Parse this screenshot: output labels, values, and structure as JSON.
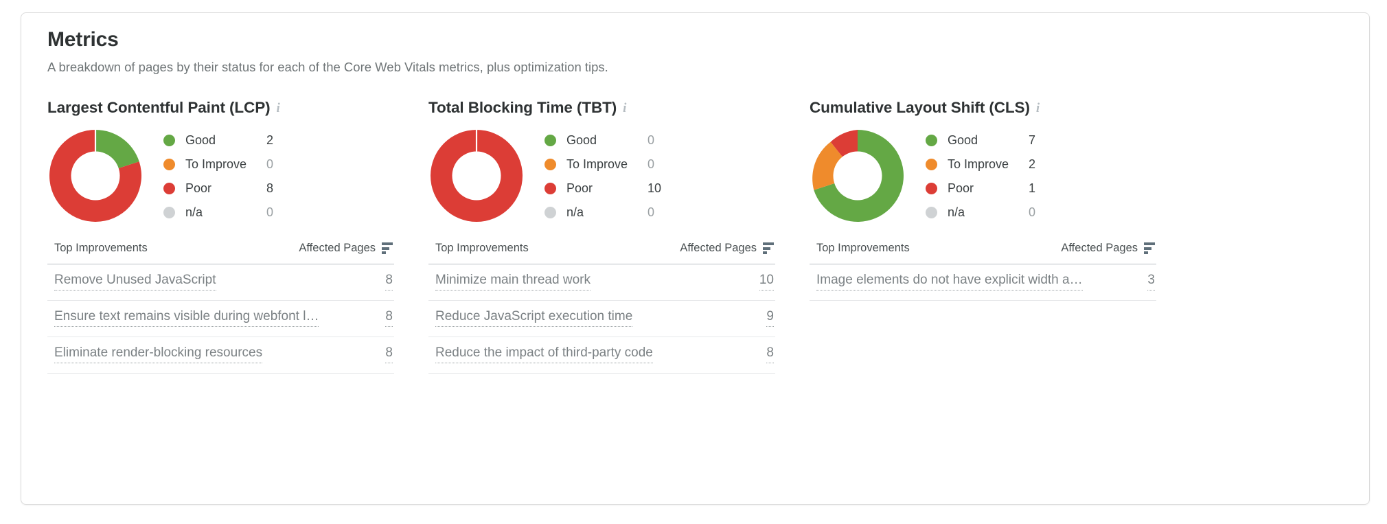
{
  "card": {
    "title": "Metrics",
    "subtitle": "A breakdown of pages by their status for each of the Core Web Vitals metrics, plus optimization tips."
  },
  "colors": {
    "good": "#64a845",
    "to_improve": "#ef8b2c",
    "poor": "#dc3d36",
    "na": "#cfd2d4",
    "title": "#2e3233",
    "subtitle": "#6f7577",
    "link": "#7b8184",
    "sort_icon": "#5f6f7a",
    "info_icon": "#b6bdc2"
  },
  "table_headers": {
    "improvements": "Top Improvements",
    "affected_pages": "Affected Pages",
    "sort_icon": "sort-descending-icon"
  },
  "metrics": [
    {
      "id": "lcp",
      "title": "Largest Contentful Paint (LCP)",
      "info_icon": "info-icon",
      "legend": [
        {
          "label": "Good",
          "value": "2",
          "color": "#64a845"
        },
        {
          "label": "To Improve",
          "value": "0",
          "color": "#ef8b2c"
        },
        {
          "label": "Poor",
          "value": "8",
          "color": "#dc3d36"
        },
        {
          "label": "n/a",
          "value": "0",
          "color": "#cfd2d4"
        }
      ],
      "rows": [
        {
          "name": "Remove Unused JavaScript",
          "value": "8"
        },
        {
          "name": "Ensure text remains visible during webfont l…",
          "value": "8"
        },
        {
          "name": "Eliminate render-blocking resources",
          "value": "8"
        }
      ]
    },
    {
      "id": "tbt",
      "title": "Total Blocking Time (TBT)",
      "info_icon": "info-icon",
      "legend": [
        {
          "label": "Good",
          "value": "0",
          "color": "#64a845"
        },
        {
          "label": "To Improve",
          "value": "0",
          "color": "#ef8b2c"
        },
        {
          "label": "Poor",
          "value": "10",
          "color": "#dc3d36"
        },
        {
          "label": "n/a",
          "value": "0",
          "color": "#cfd2d4"
        }
      ],
      "rows": [
        {
          "name": "Minimize main thread work",
          "value": "10"
        },
        {
          "name": "Reduce JavaScript execution time",
          "value": "9"
        },
        {
          "name": "Reduce the impact of third-party code",
          "value": "8"
        }
      ]
    },
    {
      "id": "cls",
      "title": "Cumulative Layout Shift (CLS)",
      "info_icon": "info-icon",
      "legend": [
        {
          "label": "Good",
          "value": "7",
          "color": "#64a845"
        },
        {
          "label": "To Improve",
          "value": "2",
          "color": "#ef8b2c"
        },
        {
          "label": "Poor",
          "value": "1",
          "color": "#dc3d36"
        },
        {
          "label": "n/a",
          "value": "0",
          "color": "#cfd2d4"
        }
      ],
      "rows": [
        {
          "name": "Image elements do not have explicit width a…",
          "value": "3"
        }
      ]
    }
  ],
  "chart_data": [
    {
      "type": "pie",
      "title": "Largest Contentful Paint (LCP)",
      "categories": [
        "Good",
        "To Improve",
        "Poor",
        "n/a"
      ],
      "values": [
        2,
        0,
        8,
        0
      ],
      "colors": [
        "#64a845",
        "#ef8b2c",
        "#dc3d36",
        "#cfd2d4"
      ],
      "total": 10,
      "donut": true,
      "legend_position": "right"
    },
    {
      "type": "pie",
      "title": "Total Blocking Time (TBT)",
      "categories": [
        "Good",
        "To Improve",
        "Poor",
        "n/a"
      ],
      "values": [
        0,
        0,
        10,
        0
      ],
      "colors": [
        "#64a845",
        "#ef8b2c",
        "#dc3d36",
        "#cfd2d4"
      ],
      "total": 10,
      "donut": true,
      "legend_position": "right"
    },
    {
      "type": "pie",
      "title": "Cumulative Layout Shift (CLS)",
      "categories": [
        "Good",
        "To Improve",
        "Poor",
        "n/a"
      ],
      "values": [
        7,
        2,
        1,
        0
      ],
      "colors": [
        "#64a845",
        "#ef8b2c",
        "#dc3d36",
        "#cfd2d4"
      ],
      "total": 10,
      "donut": true,
      "legend_position": "right"
    }
  ]
}
